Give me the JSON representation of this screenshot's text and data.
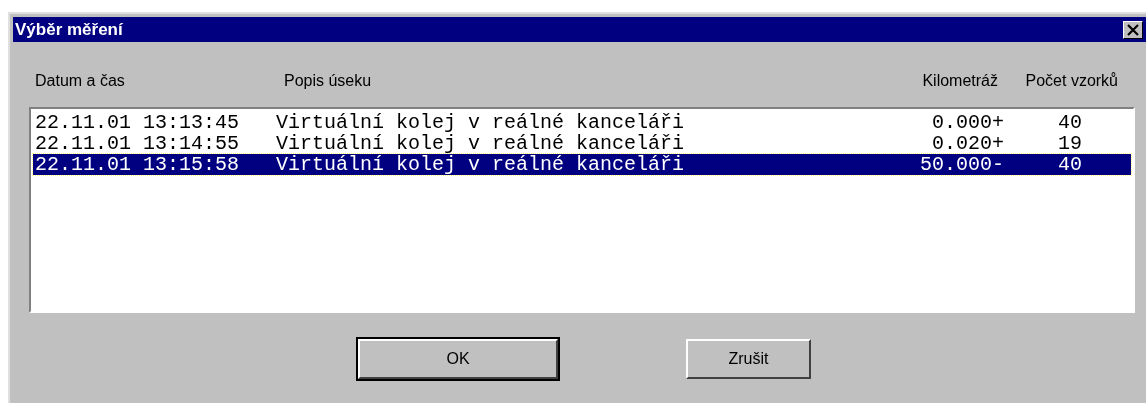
{
  "window": {
    "title": "Výběr měření"
  },
  "columns": [
    "Datum a čas",
    "Popis úseku",
    "Kilometráž",
    "Počet vzorků"
  ],
  "rows": [
    {
      "datetime": "22.11.01 13:13:45",
      "description": "Virtuální kolej v reálné kanceláři",
      "km": "0.000+",
      "samples": "40",
      "selected": false
    },
    {
      "datetime": "22.11.01 13:14:55",
      "description": "Virtuální kolej v reálné kanceláři",
      "km": "0.020+",
      "samples": "19",
      "selected": false
    },
    {
      "datetime": "22.11.01 13:15:58",
      "description": "Virtuální kolej v reálné kanceláři",
      "km": "50.000-",
      "samples": "40",
      "selected": true
    }
  ],
  "buttons": [
    {
      "label": "OK",
      "default": true
    },
    {
      "label": "Zrušit",
      "default": false
    }
  ]
}
